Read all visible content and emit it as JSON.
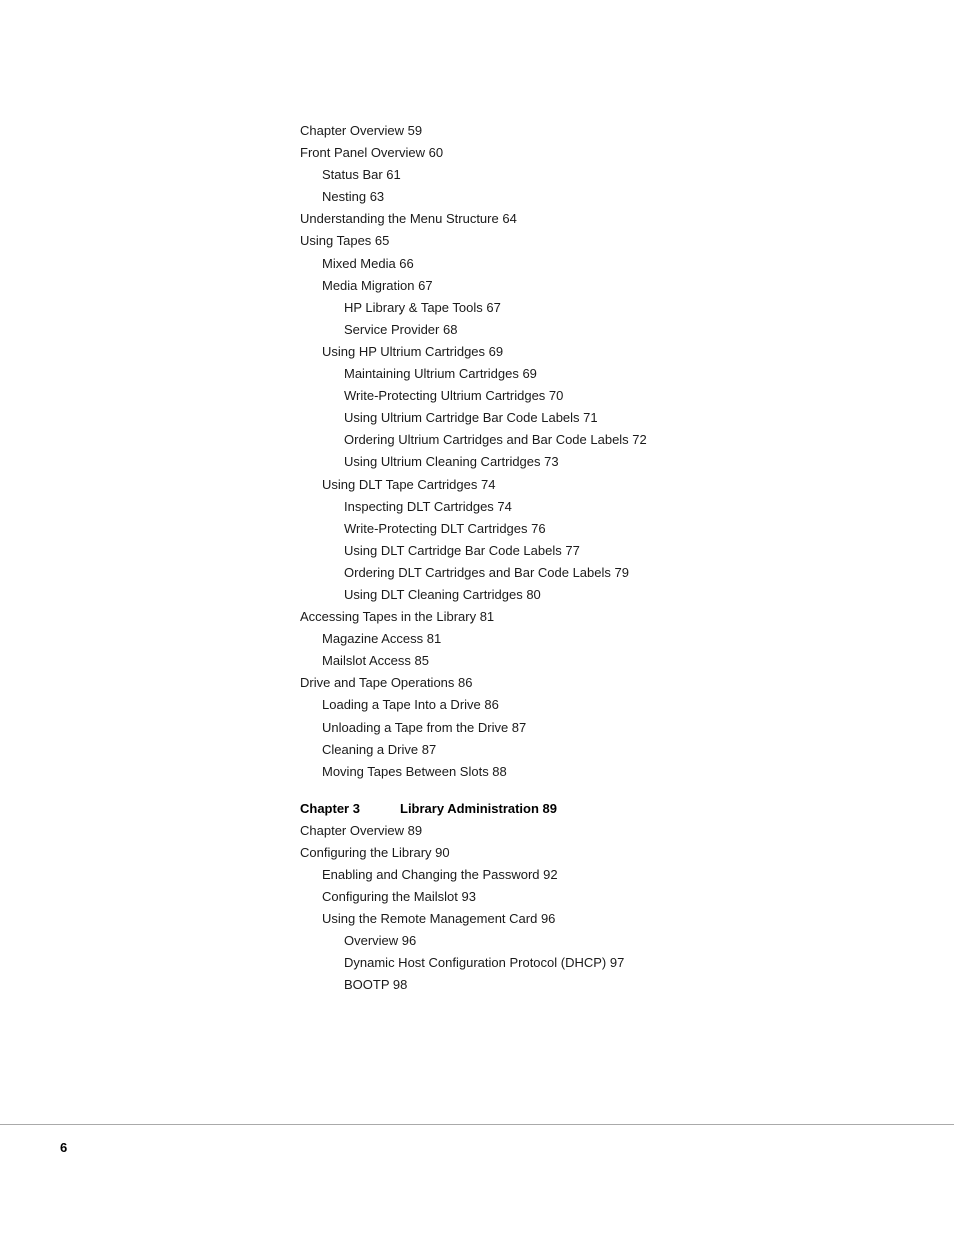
{
  "page": {
    "number": "6"
  },
  "toc": {
    "items": [
      {
        "text": "Chapter Overview 59",
        "indent": 0
      },
      {
        "text": "Front Panel Overview 60",
        "indent": 0
      },
      {
        "text": "Status Bar 61",
        "indent": 1
      },
      {
        "text": "Nesting 63",
        "indent": 1
      },
      {
        "text": "Understanding the Menu Structure 64",
        "indent": 0
      },
      {
        "text": "Using Tapes 65",
        "indent": 0
      },
      {
        "text": "Mixed Media 66",
        "indent": 1
      },
      {
        "text": "Media Migration 67",
        "indent": 1
      },
      {
        "text": "HP Library & Tape Tools 67",
        "indent": 2
      },
      {
        "text": "Service Provider 68",
        "indent": 2
      },
      {
        "text": "Using HP Ultrium Cartridges 69",
        "indent": 1
      },
      {
        "text": "Maintaining Ultrium Cartridges 69",
        "indent": 2
      },
      {
        "text": "Write-Protecting Ultrium Cartridges 70",
        "indent": 2
      },
      {
        "text": "Using Ultrium Cartridge Bar Code Labels 71",
        "indent": 2
      },
      {
        "text": "Ordering Ultrium Cartridges and Bar Code Labels 72",
        "indent": 2
      },
      {
        "text": "Using Ultrium Cleaning Cartridges 73",
        "indent": 2
      },
      {
        "text": "Using DLT Tape Cartridges 74",
        "indent": 1
      },
      {
        "text": "Inspecting DLT Cartridges 74",
        "indent": 2
      },
      {
        "text": "Write-Protecting DLT Cartridges 76",
        "indent": 2
      },
      {
        "text": "Using DLT Cartridge Bar Code Labels 77",
        "indent": 2
      },
      {
        "text": "Ordering DLT Cartridges and Bar Code Labels 79",
        "indent": 2
      },
      {
        "text": "Using DLT Cleaning Cartridges 80",
        "indent": 2
      },
      {
        "text": "Accessing Tapes in the Library 81",
        "indent": 0
      },
      {
        "text": "Magazine Access 81",
        "indent": 1
      },
      {
        "text": "Mailslot Access 85",
        "indent": 1
      },
      {
        "text": "Drive and Tape Operations 86",
        "indent": 0
      },
      {
        "text": "Loading a Tape Into a Drive 86",
        "indent": 1
      },
      {
        "text": "Unloading a Tape from the Drive 87",
        "indent": 1
      },
      {
        "text": "Cleaning a Drive 87",
        "indent": 1
      },
      {
        "text": "Moving Tapes Between Slots 88",
        "indent": 1
      }
    ],
    "chapter": {
      "label": "Chapter 3",
      "title": "Library Administration 89"
    },
    "chapter_items": [
      {
        "text": "Chapter Overview 89",
        "indent": 0
      },
      {
        "text": "Configuring the Library 90",
        "indent": 0
      },
      {
        "text": "Enabling and Changing the Password 92",
        "indent": 1
      },
      {
        "text": "Configuring the Mailslot 93",
        "indent": 1
      },
      {
        "text": "Using the Remote Management Card 96",
        "indent": 1
      },
      {
        "text": "Overview 96",
        "indent": 2
      },
      {
        "text": "Dynamic Host Configuration Protocol (DHCP) 97",
        "indent": 2
      },
      {
        "text": "BOOTP 98",
        "indent": 2
      }
    ]
  }
}
